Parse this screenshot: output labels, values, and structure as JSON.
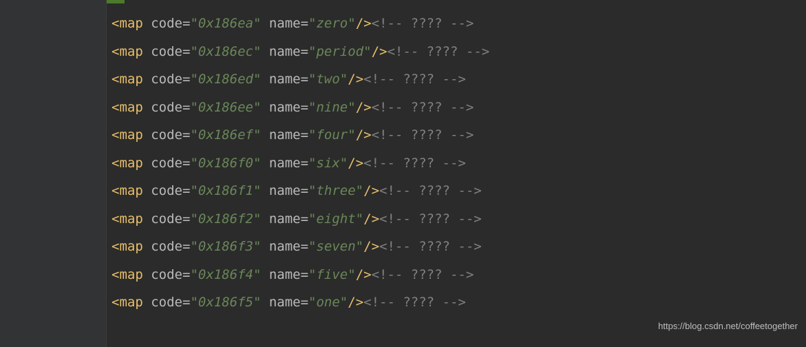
{
  "code_lines": [
    {
      "tag": "map",
      "attrs": [
        {
          "name": "code",
          "value": "0x186ea"
        },
        {
          "name": "name",
          "value": "zero"
        }
      ],
      "comment": " ???? "
    },
    {
      "tag": "map",
      "attrs": [
        {
          "name": "code",
          "value": "0x186ec"
        },
        {
          "name": "name",
          "value": "period"
        }
      ],
      "comment": " ???? "
    },
    {
      "tag": "map",
      "attrs": [
        {
          "name": "code",
          "value": "0x186ed"
        },
        {
          "name": "name",
          "value": "two"
        }
      ],
      "comment": " ???? "
    },
    {
      "tag": "map",
      "attrs": [
        {
          "name": "code",
          "value": "0x186ee"
        },
        {
          "name": "name",
          "value": "nine"
        }
      ],
      "comment": " ???? "
    },
    {
      "tag": "map",
      "attrs": [
        {
          "name": "code",
          "value": "0x186ef"
        },
        {
          "name": "name",
          "value": "four"
        }
      ],
      "comment": " ???? "
    },
    {
      "tag": "map",
      "attrs": [
        {
          "name": "code",
          "value": "0x186f0"
        },
        {
          "name": "name",
          "value": "six"
        }
      ],
      "comment": " ???? "
    },
    {
      "tag": "map",
      "attrs": [
        {
          "name": "code",
          "value": "0x186f1"
        },
        {
          "name": "name",
          "value": "three"
        }
      ],
      "comment": " ???? "
    },
    {
      "tag": "map",
      "attrs": [
        {
          "name": "code",
          "value": "0x186f2"
        },
        {
          "name": "name",
          "value": "eight"
        }
      ],
      "comment": " ???? "
    },
    {
      "tag": "map",
      "attrs": [
        {
          "name": "code",
          "value": "0x186f3"
        },
        {
          "name": "name",
          "value": "seven"
        }
      ],
      "comment": " ???? "
    },
    {
      "tag": "map",
      "attrs": [
        {
          "name": "code",
          "value": "0x186f4"
        },
        {
          "name": "name",
          "value": "five"
        }
      ],
      "comment": " ???? "
    },
    {
      "tag": "map",
      "attrs": [
        {
          "name": "code",
          "value": "0x186f5"
        },
        {
          "name": "name",
          "value": "one"
        }
      ],
      "comment": " ???? "
    }
  ],
  "watermark": "https://blog.csdn.net/coffeetogether"
}
